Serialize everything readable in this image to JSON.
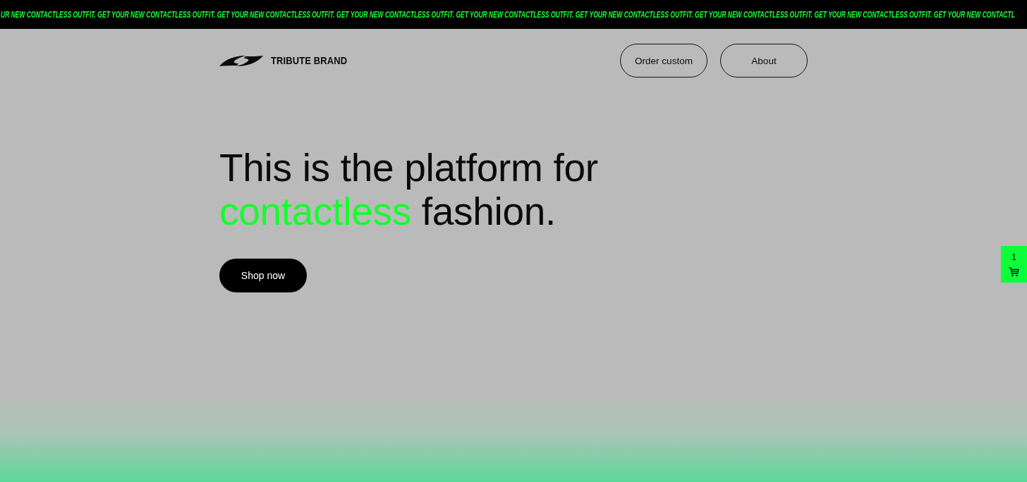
{
  "announcement_bar": {
    "text": "UR NEW CONTACTLESS OUTFIT. GET YOUR NEW CONTACTLESS OUTFIT. GET YOUR NEW CONTACTLESS OUTFIT. GET YOUR NEW CONTACTLESS OUTFIT. GET YOUR NEW CONTACTLESS OUTFIT. GET YOUR NEW CONTACTLESS OUTFIT. GET YOUR NEW CONTACTLESS OUTFIT. GET YOUR NEW CONTACTLESS OUTFIT. GET YOUR NEW CONTACTL"
  },
  "header": {
    "brand": "TRIBUTE BRAND",
    "nav": [
      "Order custom",
      "About"
    ]
  },
  "hero": {
    "heading": [
      {
        "text": "This is the platform for",
        "highlight": false
      },
      {
        "text": "contactless",
        "highlight": true
      },
      {
        "text": "fashion.",
        "highlight": false
      }
    ],
    "button": "Shop now"
  },
  "cart": {
    "count": "1"
  }
}
